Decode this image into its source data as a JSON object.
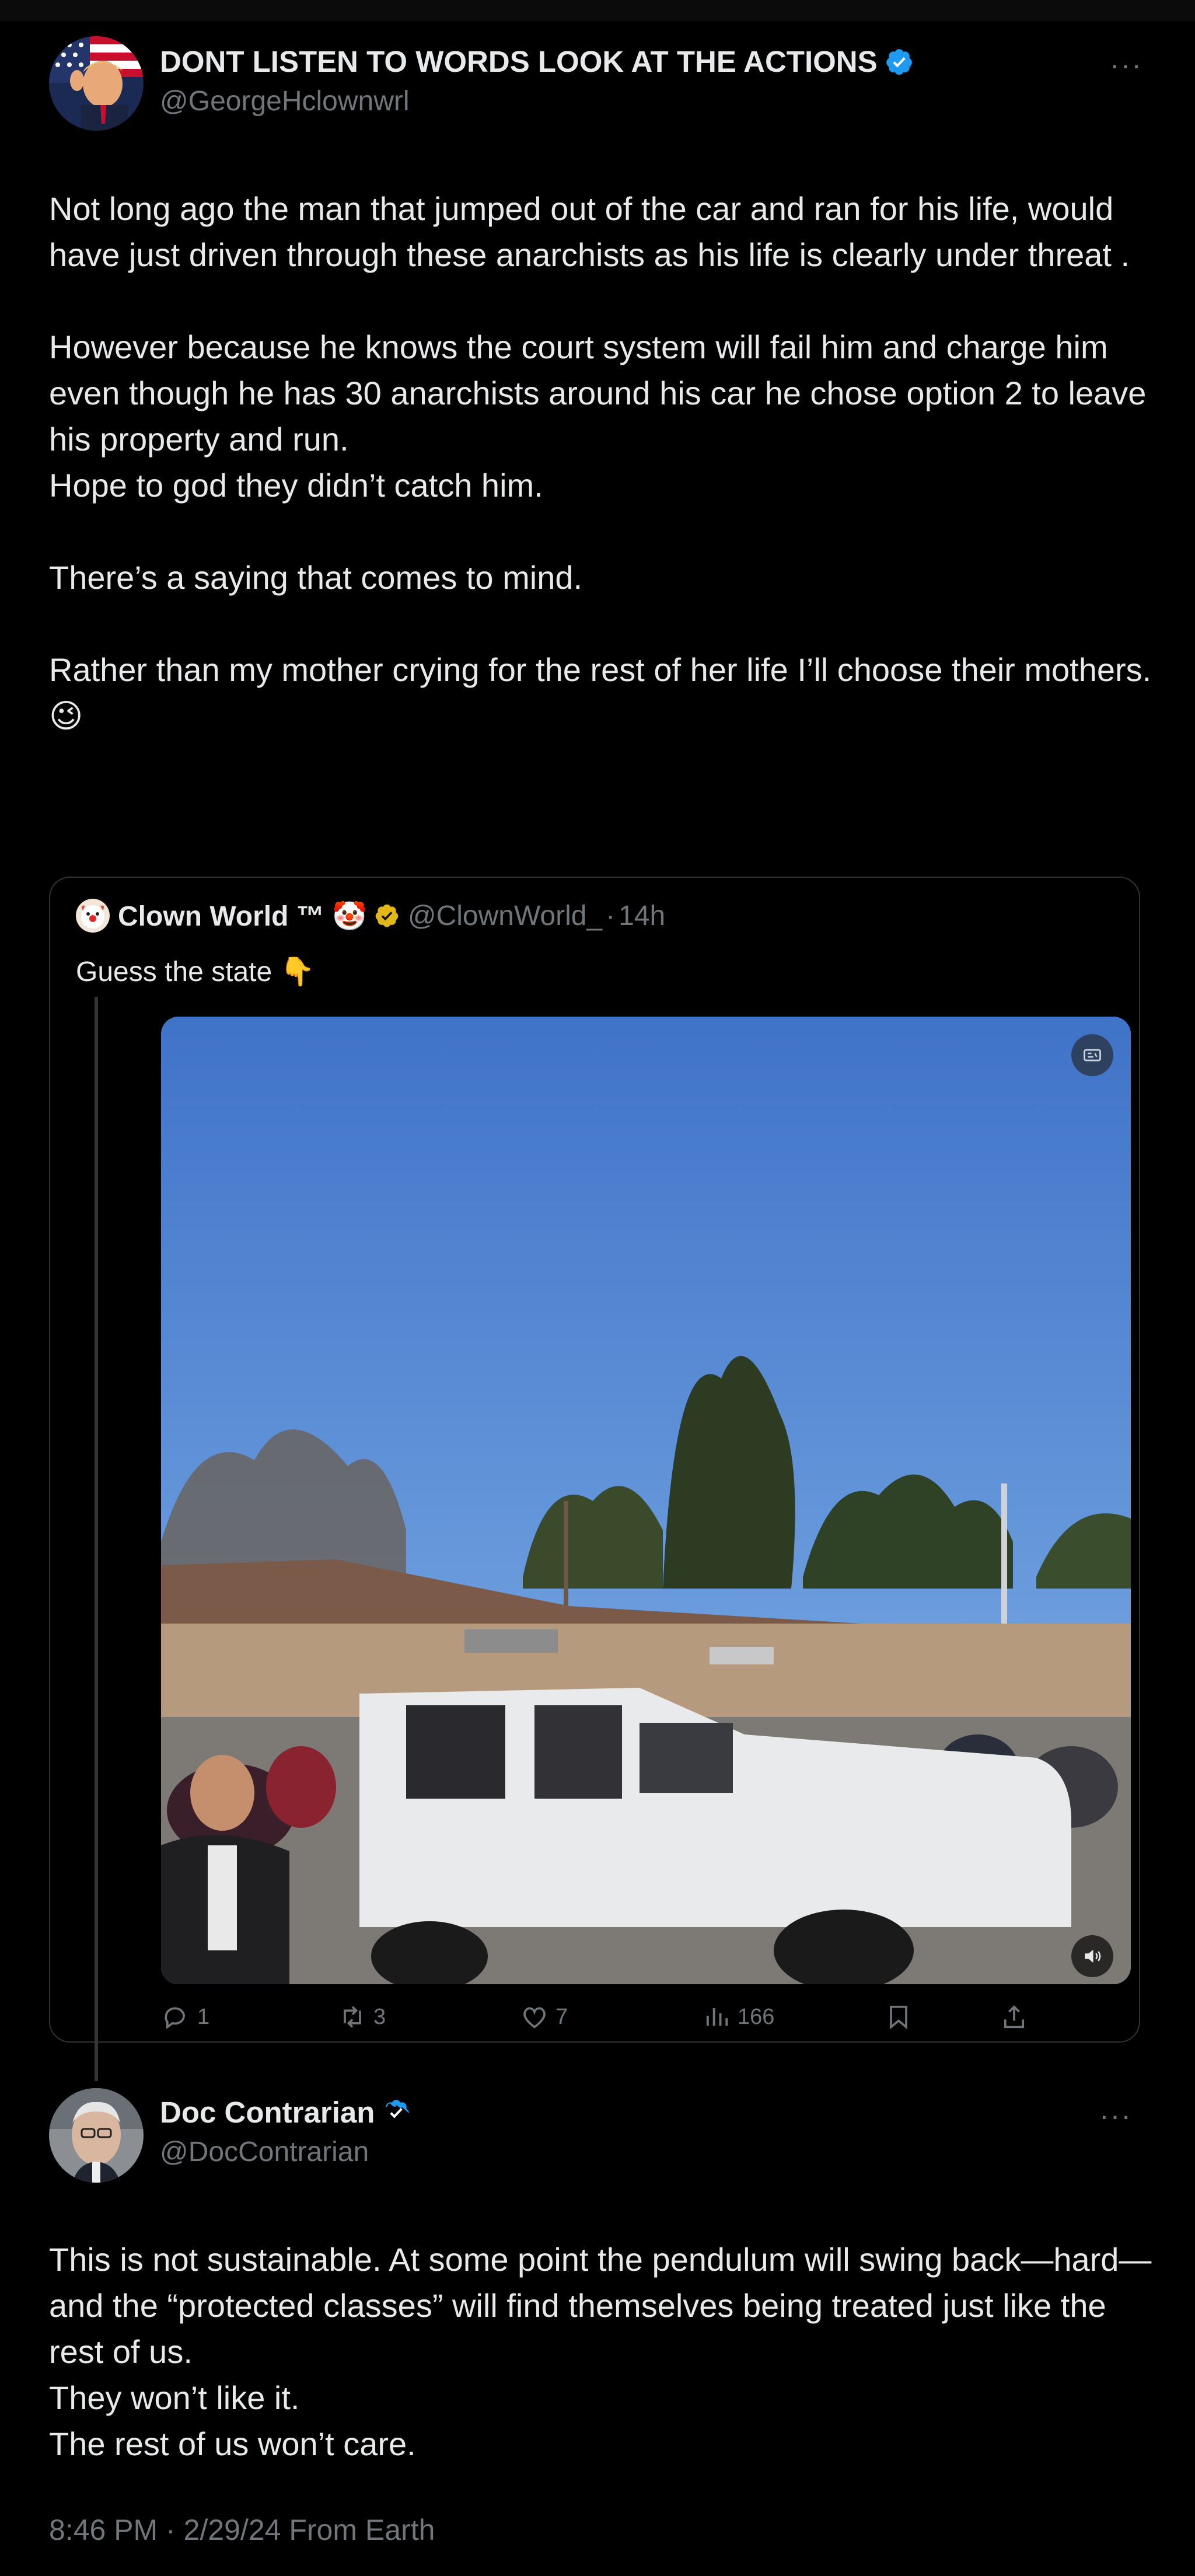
{
  "post": {
    "author": {
      "display_name": "DONT LISTEN TO WORDS LOOK AT THE ACTIONS",
      "handle": "@GeorgeHclownwrl",
      "verified": true
    },
    "more_icon": "more-horizontal-icon",
    "paragraphs": [
      "Not long ago the man that jumped out of the car and ran for his life, would have just driven through these anarchists as his life is clearly under threat .",
      "However because he knows the court system will fail him and charge him even though he has 30 anarchists around his car he chose option 2 to leave his property and run.\nHope to god they didn’t catch him.",
      "There’s a saying that comes to mind.",
      "Rather than my mother crying for the rest of her life I’ll choose their mothers.\n😉"
    ],
    "quoted": {
      "display_name": "Clown World ™ 🤡",
      "handle": "@ClownWorld_",
      "separator": "·",
      "time": "14h",
      "verified_badge": "gold-check-icon",
      "text": "Guess the state 👇",
      "media": {
        "type": "video",
        "badge_icon": "gif-icon",
        "sound_icon": "volume-icon"
      }
    },
    "actions": {
      "replies": "1",
      "reposts": "3",
      "likes": "7",
      "views": "166",
      "icons": [
        "reply-icon",
        "retweet-icon",
        "like-icon",
        "views-icon",
        "bookmark-icon",
        "share-icon"
      ]
    }
  },
  "reply": {
    "author": {
      "display_name": "Doc Contrarian",
      "handle": "@DocContrarian",
      "verified": true
    },
    "more_icon": "more-horizontal-icon",
    "lines": "This is not sustainable. At some point the pendulum will swing back—hard—and the “protected classes” will find themselves being treated just like the rest of us.\nThey won’t like it.\nThe rest of us won’t care.",
    "timestamp": "8:46 PM · 2/29/24 From Earth"
  },
  "colors": {
    "background": "#000000",
    "text": "#e7e9ea",
    "muted": "#71767b",
    "border": "#2f3336",
    "verified_blue": "#1d9bf0",
    "verified_gold": "#e2b719"
  }
}
